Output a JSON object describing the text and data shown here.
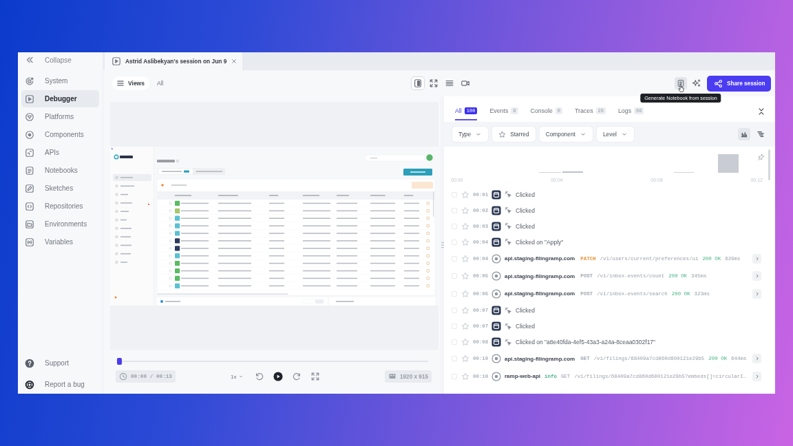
{
  "sidebar": {
    "collapse": "Collapse",
    "items": [
      {
        "label": "System",
        "selected": false
      },
      {
        "label": "Debugger",
        "selected": true
      },
      {
        "label": "Platforms",
        "selected": false
      },
      {
        "label": "Components",
        "selected": false
      },
      {
        "label": "APIs",
        "selected": false
      },
      {
        "label": "Notebooks",
        "selected": false
      },
      {
        "label": "Sketches",
        "selected": false
      },
      {
        "label": "Repositories",
        "selected": false
      },
      {
        "label": "Environments",
        "selected": false
      },
      {
        "label": "Variables",
        "selected": false
      }
    ],
    "footer": [
      {
        "label": "Support"
      },
      {
        "label": "Report a bug"
      }
    ]
  },
  "tabs": [
    {
      "title": "Astrid Aslibekyan's session on Jun 9",
      "selected": true
    }
  ],
  "toolbar": {
    "views": "Views",
    "filter": "All",
    "view_modes": [
      {
        "selected": true
      },
      {
        "selected": false
      },
      {
        "selected": false
      },
      {
        "selected": false
      }
    ],
    "tooltip": "Generate Notebook from session",
    "share": "Share session"
  },
  "player": {
    "progress": {
      "level": 0
    },
    "time": "00:00 / 00:13",
    "speed": "1x",
    "resolution": "1920 x 915"
  },
  "panel": {
    "tabs": [
      {
        "label": "All",
        "count": "100",
        "selected": true
      },
      {
        "label": "Events",
        "count": "8",
        "selected": false
      },
      {
        "label": "Console",
        "count": "0",
        "selected": false
      },
      {
        "label": "Traces",
        "count": "26",
        "selected": false
      },
      {
        "label": "Logs",
        "count": "66",
        "selected": false
      }
    ],
    "filters": [
      {
        "kind": "dropdown",
        "label": "Type"
      },
      {
        "kind": "toggle",
        "label": "Starred",
        "on": false
      },
      {
        "kind": "dropdown",
        "label": "Component"
      },
      {
        "kind": "dropdown",
        "label": "Level"
      }
    ],
    "chart_modes": [
      {
        "selected": true
      },
      {
        "selected": false
      }
    ],
    "timeline": {
      "ticks": [
        "00:00",
        "00:04",
        "00:08",
        "00:12"
      ]
    },
    "events": [
      {
        "kind": "click",
        "checked": false,
        "starred": false,
        "time": "00:01",
        "text": "Clicked"
      },
      {
        "kind": "click",
        "checked": false,
        "starred": false,
        "time": "00:02",
        "text": "Clicked"
      },
      {
        "kind": "click",
        "checked": false,
        "starred": false,
        "time": "00:03",
        "text": "Clicked"
      },
      {
        "kind": "click",
        "checked": false,
        "starred": false,
        "time": "00:04",
        "text": "Clicked on \"Apply\""
      },
      {
        "kind": "request",
        "checked": false,
        "starred": false,
        "time": "00:04",
        "host": "api.staging-filingramp.com",
        "method": "PATCH",
        "color": "#e8953f",
        "path": "/v1/users/current/preferences/ui",
        "status": "200 OK",
        "duration": "629ms"
      },
      {
        "kind": "request",
        "checked": false,
        "starred": false,
        "time": "00:05",
        "host": "api.staging-filingramp.com",
        "method": "POST",
        "color": "#a3a8b0",
        "path": "/v1/inbox-events/count",
        "status": "200 OK",
        "duration": "345ms"
      },
      {
        "kind": "request",
        "checked": false,
        "starred": false,
        "time": "00:05",
        "host": "api.staging-filingramp.com",
        "method": "POST",
        "color": "#a3a8b0",
        "path": "/v1/inbox-events/search",
        "status": "200 OK",
        "duration": "323ms"
      },
      {
        "kind": "click",
        "checked": false,
        "starred": false,
        "time": "00:07",
        "text": "Clicked"
      },
      {
        "kind": "click",
        "checked": false,
        "starred": false,
        "time": "00:07",
        "text": "Clicked"
      },
      {
        "kind": "click",
        "checked": false,
        "starred": false,
        "time": "00:08",
        "text": "Clicked on \"a8e40fda-4ef5-43a3-a24a-8ceaa0302f17\""
      },
      {
        "kind": "request",
        "checked": false,
        "starred": false,
        "time": "00:10",
        "host": "api.staging-filingramp.com",
        "method": "GET",
        "color": "#a3a8b0",
        "path": "/v1/filings/68409a7cd860d600121e29b5",
        "status": "200 OK",
        "duration": "644ms"
      },
      {
        "kind": "log",
        "checked": false,
        "starred": false,
        "time": "00:10",
        "source": "ramp-web-api",
        "severity": "info",
        "color": "#45b483",
        "method": "GET",
        "path": "/v1/filings/68409a7cd860d600121e29b5?embeds[]=circularI…"
      }
    ]
  }
}
